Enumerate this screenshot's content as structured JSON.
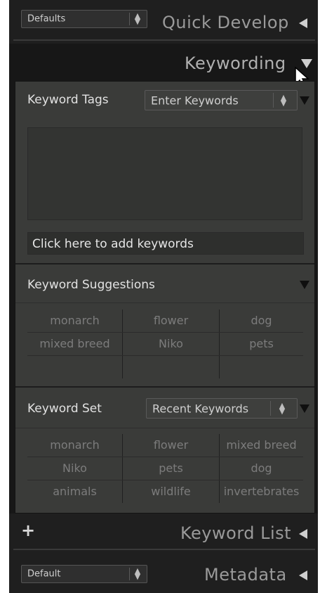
{
  "quick_develop": {
    "preset": "Defaults",
    "title": "Quick Develop"
  },
  "keywording": {
    "title": "Keywording",
    "keyword_tags": {
      "label": "Keyword Tags",
      "mode": "Enter Keywords",
      "add_placeholder": "Click here to add keywords"
    },
    "suggestions": {
      "label": "Keyword Suggestions",
      "rows": [
        [
          "monarch",
          "flower",
          "dog"
        ],
        [
          "mixed breed",
          "Niko",
          "pets"
        ],
        [
          "",
          "",
          ""
        ]
      ]
    },
    "keyword_set": {
      "label": "Keyword Set",
      "set_name": "Recent Keywords",
      "rows": [
        [
          "monarch",
          "flower",
          "mixed breed"
        ],
        [
          "Niko",
          "pets",
          "dog"
        ],
        [
          "animals",
          "wildlife",
          "invertebrates"
        ]
      ]
    }
  },
  "keyword_list": {
    "add_symbol": "+",
    "title": "Keyword List"
  },
  "metadata": {
    "preset": "Default",
    "title": "Metadata"
  },
  "icons": {
    "collapse": "left-triangle-icon",
    "expand": "down-triangle-icon",
    "cursor": "mouse-pointer-icon",
    "select_arrows": "up-down-arrows-icon"
  },
  "colors": {
    "panel_bg": "#3a3b39",
    "header_bg": "#1f1f1f",
    "title_text": "#9a9a9a"
  }
}
